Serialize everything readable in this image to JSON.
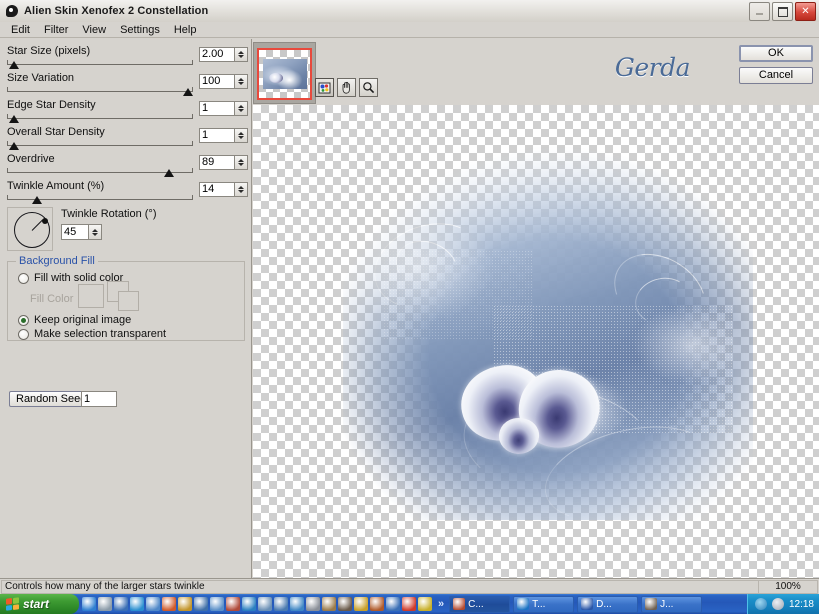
{
  "window": {
    "title": "Alien Skin Xenofex 2 Constellation",
    "icon": "alien-skin-icon",
    "controls": {
      "minimize": "minimize-button",
      "maximize": "maximize-button",
      "close": "close-button",
      "close_glyph": "✕"
    }
  },
  "menubar": {
    "items": [
      {
        "label": "Edit"
      },
      {
        "label": "Filter"
      },
      {
        "label": "View"
      },
      {
        "label": "Settings"
      },
      {
        "label": "Help"
      }
    ]
  },
  "controls": {
    "sliders": [
      {
        "label": "Star Size (pixels)",
        "value": "2.00",
        "percent": 1
      },
      {
        "label": "Size Variation",
        "value": "100",
        "percent": 100
      },
      {
        "label": "Edge Star Density",
        "value": "1",
        "percent": 1
      },
      {
        "label": "Overall Star Density",
        "value": "1",
        "percent": 1
      },
      {
        "label": "Overdrive",
        "value": "89",
        "percent": 89
      },
      {
        "label": "Twinkle Amount (%)",
        "value": "14",
        "percent": 14
      }
    ],
    "rotation": {
      "label": "Twinkle Rotation (°)",
      "value": "45",
      "dial_icon": "rotation-dial-icon"
    },
    "background_fill": {
      "title": "Background Fill",
      "options": [
        {
          "label": "Fill with solid color",
          "selected": false
        },
        {
          "label": "Keep original image",
          "selected": true
        },
        {
          "label": "Make selection transparent",
          "selected": false
        }
      ],
      "fill_color_label": "Fill Color"
    },
    "random_seed": {
      "button_label": "Random Seed",
      "value": "1"
    }
  },
  "toolbar": {
    "thumbnail_name": "preview-thumbnail",
    "tools": [
      {
        "name": "color-preview-tool",
        "active": true
      },
      {
        "name": "pan-hand-tool",
        "active": false
      },
      {
        "name": "zoom-magnifier-tool",
        "active": false
      }
    ],
    "brand": "Gerda",
    "ok_label": "OK",
    "cancel_label": "Cancel"
  },
  "preview": {
    "name": "image-preview-canvas",
    "description": "blue and white floral artwork on transparency checkerboard"
  },
  "statusbar": {
    "hint": "Controls how many of the larger stars twinkle",
    "zoom": "100%"
  },
  "taskbar": {
    "start_label": "start",
    "quick_launch_count": 22,
    "overflow_glyph": "»",
    "tasks": [
      {
        "label": "C...",
        "active": true,
        "color": "#b4492e"
      },
      {
        "label": "T...",
        "active": false,
        "color": "#1b73c4"
      },
      {
        "label": "D...",
        "active": false,
        "color": "#2a56a8"
      },
      {
        "label": "J...",
        "active": false,
        "color": "#6e6052"
      }
    ],
    "clock": "12:18",
    "tray_icons": [
      "back-arrow-icon",
      "user-account-icon"
    ]
  },
  "colors": {
    "panel": "#d6d3ce",
    "group_title": "#2a52a8",
    "brand": "#4a6a96",
    "thumb_border": "#e8493c",
    "taskbar": "#2558b8",
    "start": "#3e9b33"
  }
}
